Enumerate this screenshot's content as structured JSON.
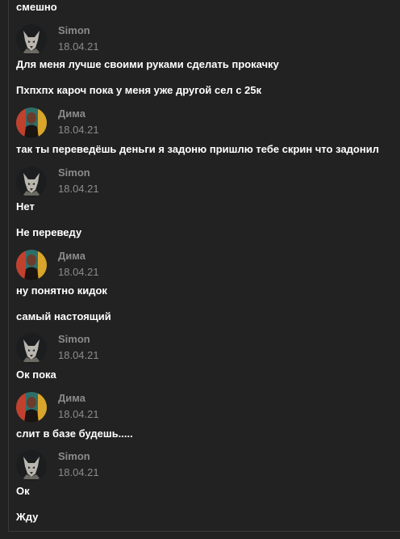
{
  "messages": {
    "m0": "смешно",
    "m1": "Для меня лучше своими руками сделать прокачку",
    "m2": "Пхпхпх кароч пока у меня уже другой сел с 25к",
    "m3": "так ты переведёшь деньги я задоню пришлю тебе скрин что задонил",
    "m4": "Нет",
    "m5": "Не переведу",
    "m6": "ну понятно кидок",
    "m7": "самый настоящий",
    "m8": "Ок пока",
    "m9": "слит в базе будешь.....",
    "m10": "Ок",
    "m11": "Жду"
  },
  "authors": {
    "simon": "Simon",
    "dima": "Дима"
  },
  "headers": {
    "h1": {
      "date": "18.04.21"
    },
    "h2": {
      "date": "18.04.21"
    },
    "h3": {
      "date": "18.04.21"
    },
    "h4": {
      "date": "18.04.21"
    },
    "h5": {
      "date": "18.04.21"
    },
    "h6": {
      "date": "18.04.21"
    },
    "h7": {
      "date": "18.04.21"
    }
  },
  "avatars": {
    "simon": "wolf-avatar-icon",
    "dima": "person-avatar-icon"
  },
  "colors": {
    "background": "#222222",
    "text": "#ffffff",
    "meta": "#8b8b8b"
  }
}
